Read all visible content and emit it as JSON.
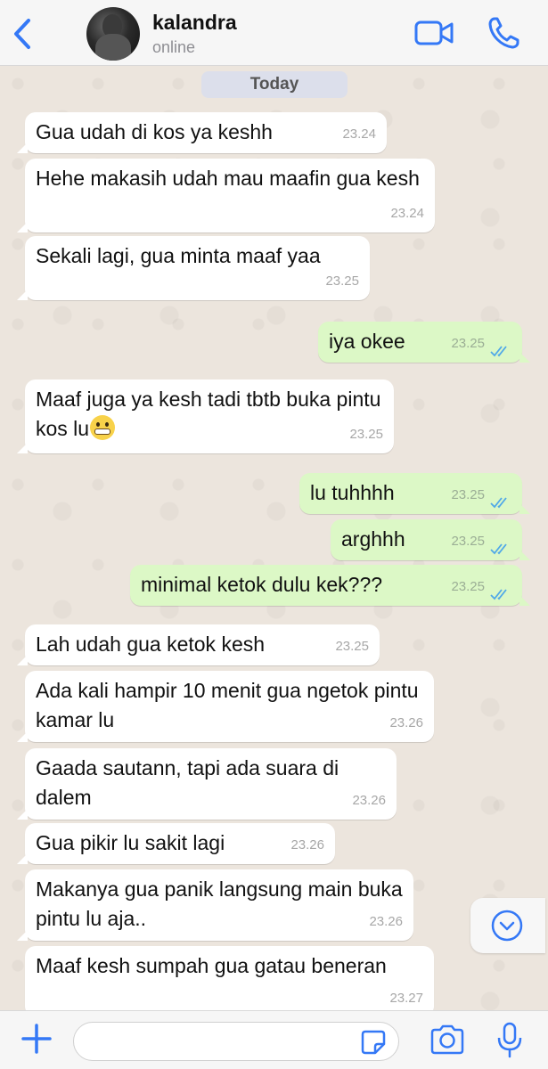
{
  "header": {
    "contact_name": "kalandra",
    "status": "online"
  },
  "chat": {
    "date_label": "Today",
    "messages": [
      {
        "dir": "in",
        "text": "Gua udah di kos ya keshh",
        "time": "23.24"
      },
      {
        "dir": "in",
        "text": "Hehe makasih udah mau maafin gua kesh",
        "time": "23.24"
      },
      {
        "dir": "in",
        "text": "Sekali lagi, gua minta maaf yaa",
        "time": "23.25"
      },
      {
        "dir": "out",
        "text": "iya okee",
        "time": "23.25"
      },
      {
        "dir": "in",
        "text": "Maaf juga ya kesh tadi tbtb buka pintu kos lu",
        "time": "23.25",
        "emoji": "grimacing-face-emoji"
      },
      {
        "dir": "out",
        "text": "lu tuhhhh",
        "time": "23.25"
      },
      {
        "dir": "out",
        "text": "arghhh",
        "time": "23.25"
      },
      {
        "dir": "out",
        "text": "minimal ketok dulu kek???",
        "time": "23.25"
      },
      {
        "dir": "in",
        "text": "Lah udah gua ketok kesh",
        "time": "23.25"
      },
      {
        "dir": "in",
        "text": "Ada kali hampir 10 menit gua ngetok pintu kamar lu",
        "time": "23.26"
      },
      {
        "dir": "in",
        "text": "Gaada sautann, tapi ada suara di dalem",
        "time": "23.26"
      },
      {
        "dir": "in",
        "text": "Gua pikir lu sakit lagi",
        "time": "23.26"
      },
      {
        "dir": "in",
        "text": "Makanya gua panik langsung main buka pintu lu aja..",
        "time": "23.26"
      },
      {
        "dir": "in",
        "text": "Maaf kesh sumpah gua gatau beneran",
        "time": "23.27"
      }
    ]
  },
  "footer": {
    "input_value": ""
  },
  "icons": {
    "back": "chevron-left-icon",
    "video": "video-camera-icon",
    "call": "phone-icon",
    "scroll": "chevron-down-circle-icon",
    "plus": "plus-icon",
    "sticker": "sticker-icon",
    "camera": "camera-icon",
    "mic": "microphone-icon",
    "read_receipt": "double-check-icon"
  },
  "colors": {
    "accent": "#3478F6",
    "incoming_bubble": "#FFFFFF",
    "outgoing_bubble": "#DCF8C6",
    "read_tick": "#4FA8E8"
  }
}
